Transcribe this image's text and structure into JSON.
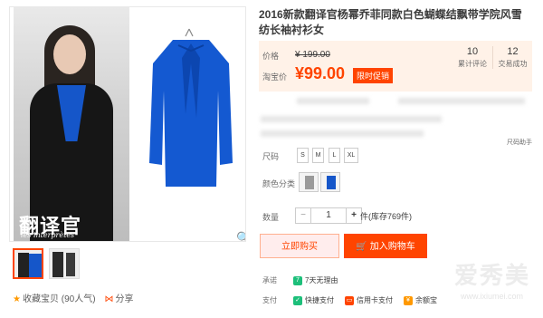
{
  "product": {
    "title": "2016新款翻译官杨幂乔菲同款白色蝴蝶结飘带学院风雪纺长袖衬衫女",
    "gallery_overlay_title": "翻译官",
    "gallery_overlay_sub": "les interprètes"
  },
  "price": {
    "label_price": "价格",
    "original": "¥ 199.00",
    "label_taobao": "淘宝价",
    "current": "¥99.00",
    "promo": "限时促销",
    "stats": [
      {
        "value": "10",
        "label": "累计评论"
      },
      {
        "value": "12",
        "label": "交易成功"
      }
    ]
  },
  "options": {
    "size_chart": "尺码助手",
    "size_label": "尺码",
    "sizes": [
      "S",
      "M",
      "L",
      "XL"
    ],
    "color_label": "颜色分类",
    "colors": [
      "#9a9a9a",
      "#1556c9"
    ],
    "qty_label": "数量",
    "qty_minus": "−",
    "qty_value": "1",
    "qty_plus": "+",
    "stock": "件(库存769件)"
  },
  "buttons": {
    "buy": "立即购买",
    "cart": "加入购物车",
    "cart_icon": "cart-icon"
  },
  "info": {
    "promise_label": "承诺",
    "promise_badge": "7",
    "promise_text": "7天无理由",
    "pay_label": "支付",
    "pay_methods": [
      "快捷支付",
      "信用卡支付",
      "余额宝"
    ]
  },
  "side": {
    "favorite": "收藏宝贝 (90人气)",
    "share": "分享"
  },
  "watermark": {
    "brand": "爱秀美",
    "url": "www.ixiumei.com"
  },
  "colors": {
    "accent": "#ff4400",
    "price_bg": "#fff2e8"
  }
}
